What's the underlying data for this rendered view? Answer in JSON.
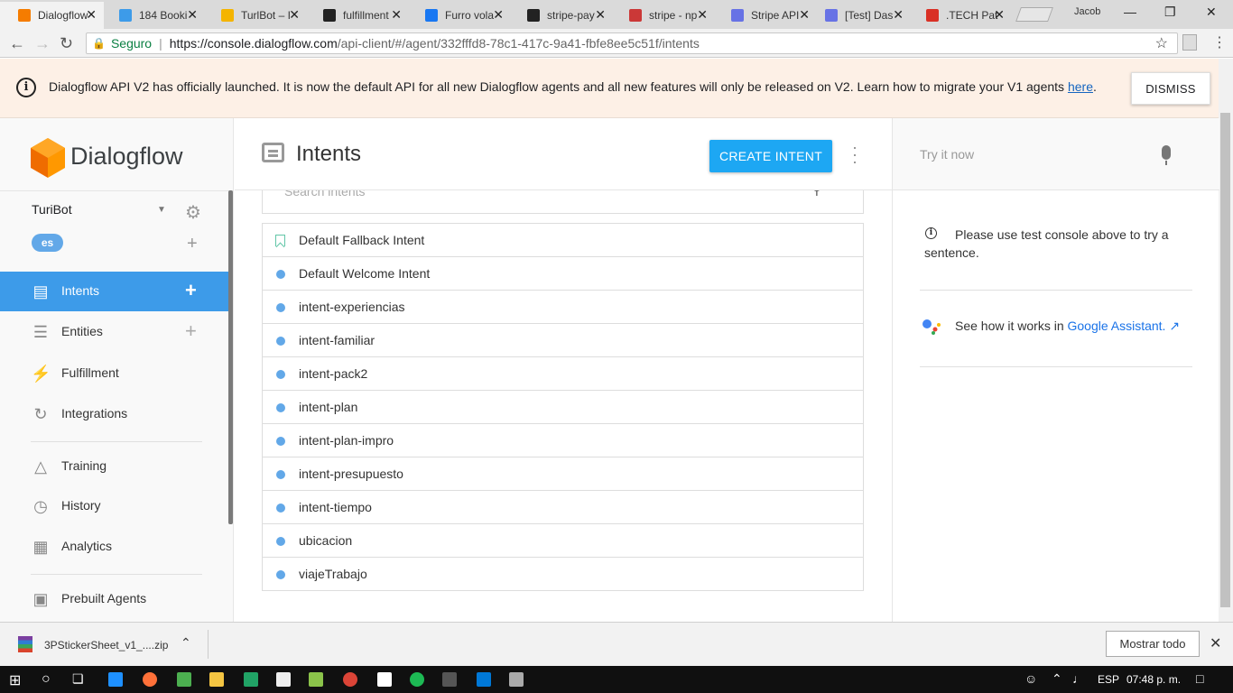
{
  "browser": {
    "tabs": [
      {
        "label": "Dialogflow",
        "color": "#f57c00",
        "active": true
      },
      {
        "label": "184 Booki",
        "color": "#3d9be9"
      },
      {
        "label": "TurlBot – I",
        "color": "#f4b400"
      },
      {
        "label": "fulfillment",
        "color": "#222222"
      },
      {
        "label": "Furro vola",
        "color": "#1877f2"
      },
      {
        "label": "stripe-pay",
        "color": "#222222"
      },
      {
        "label": "stripe - np",
        "color": "#cb3837"
      },
      {
        "label": "Stripe API",
        "color": "#6772e5"
      },
      {
        "label": "[Test] Das",
        "color": "#6772e5"
      },
      {
        "label": ".TECH Pat",
        "color": "#d93025"
      }
    ],
    "profile": "Jacob",
    "address": {
      "secure_label": "Seguro",
      "host": "https://console.dialogflow.com",
      "path": "/api-client/#/agent/332fffd8-78c1-417c-9a41-fbfe8ee5c51f/intents"
    }
  },
  "banner": {
    "text": "Dialogflow API V2 has officially launched. It is now the default API for all new Dialogflow agents and all new features will only be released on V2. Learn how to migrate your V1 agents ",
    "link": "here",
    "after_link": ".",
    "dismiss": "DISMISS"
  },
  "sidebar": {
    "brand": "Dialogflow",
    "agent": "TuriBot",
    "language": "es",
    "nav": [
      {
        "label": "Intents",
        "icon": "chat-icon",
        "active": true,
        "plus": true
      },
      {
        "label": "Entities",
        "icon": "hierarchy-icon",
        "plus": true
      },
      {
        "label": "Fulfillment",
        "icon": "bolt-icon"
      },
      {
        "label": "Integrations",
        "icon": "sync-icon"
      },
      {
        "label": "Training",
        "icon": "graduation-icon"
      },
      {
        "label": "History",
        "icon": "clock-icon"
      },
      {
        "label": "Analytics",
        "icon": "chart-icon"
      },
      {
        "label": "Prebuilt Agents",
        "icon": "book-icon"
      }
    ]
  },
  "main": {
    "title": "Intents",
    "create_button": "CREATE INTENT",
    "search_placeholder": "Search intents",
    "intents": [
      {
        "name": "Default Fallback Intent",
        "fallback": true
      },
      {
        "name": "Default Welcome Intent"
      },
      {
        "name": "intent-experiencias"
      },
      {
        "name": "intent-familiar"
      },
      {
        "name": "intent-pack2"
      },
      {
        "name": "intent-plan"
      },
      {
        "name": "intent-plan-impro"
      },
      {
        "name": "intent-presupuesto"
      },
      {
        "name": "intent-tiempo"
      },
      {
        "name": "ubicacion"
      },
      {
        "name": "viajeTrabajo"
      }
    ]
  },
  "right_panel": {
    "try_placeholder": "Try it now",
    "info": "Please use test console above to try a sentence.",
    "assistant_prefix": "See how it works in ",
    "assistant_link": "Google Assistant."
  },
  "downloads": {
    "file": "3PStickerSheet_v1_....zip",
    "show_all": "Mostrar todo"
  },
  "taskbar": {
    "lang": "ESP",
    "time": "07:48 p. m."
  },
  "colors": {
    "accent": "#3d9be9",
    "create_button": "#1da7f3",
    "banner_bg": "#fdf0e6",
    "dialogflow_orange": "#f57c00"
  }
}
